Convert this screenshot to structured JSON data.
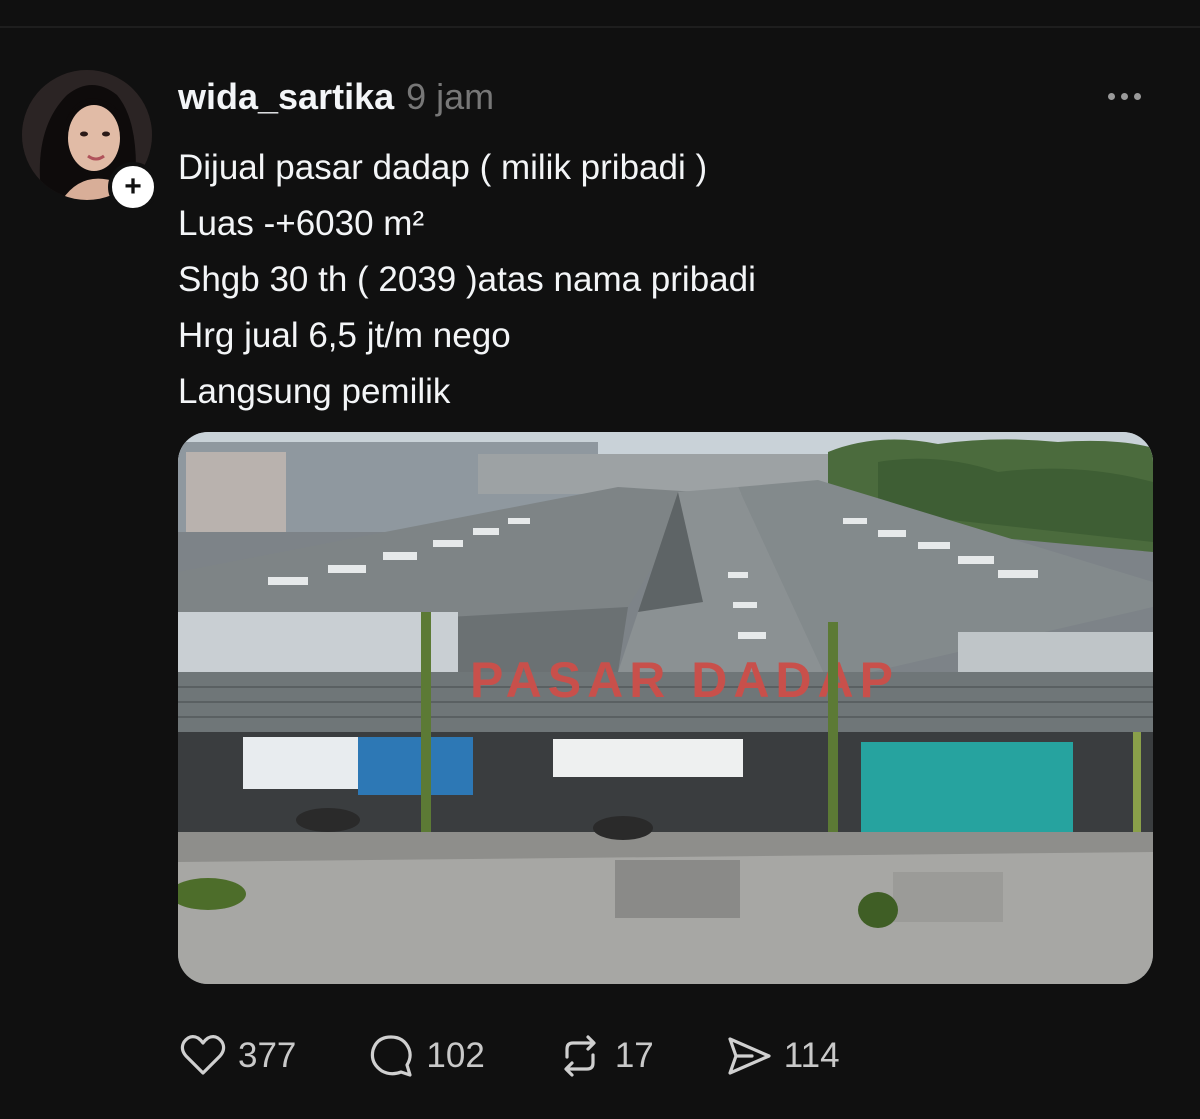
{
  "post": {
    "username": "wida_sartika",
    "timestamp": "9 jam",
    "follow_symbol": "+",
    "lines": [
      "Dijual pasar dadap ( milik pribadi )",
      "Luas -+6030 m²",
      "Shgb 30 th ( 2039 )atas nama pribadi",
      "Hrg jual 6,5 jt/m nego",
      "Langsung pemilik"
    ],
    "media": {
      "sign_text": "PASAR DADAP"
    },
    "actions": {
      "likes": "377",
      "replies": "102",
      "reposts": "17",
      "shares": "114"
    }
  },
  "icons": {
    "more": "more-horizontal-icon",
    "like": "heart-icon",
    "reply": "speech-bubble-icon",
    "repost": "repost-arrows-icon",
    "share": "send-icon",
    "follow": "plus-icon"
  },
  "colors": {
    "background": "#101010",
    "text": "#f3f5f7",
    "muted": "#777777"
  }
}
